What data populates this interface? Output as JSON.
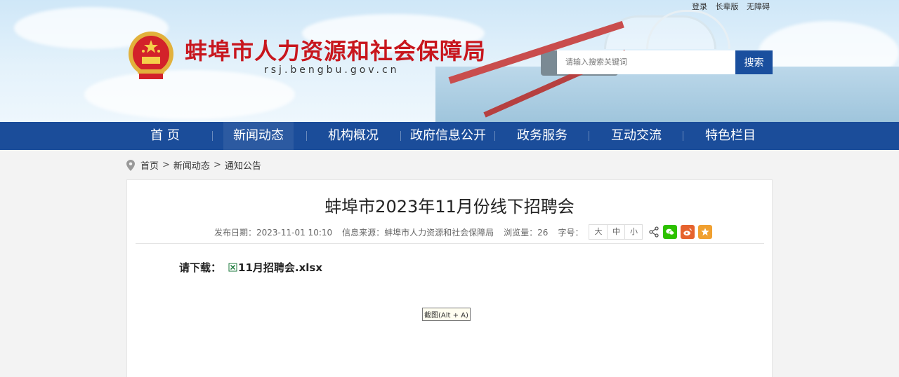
{
  "top_links": [
    "登录",
    "长辈版",
    "无障碍"
  ],
  "site": {
    "title": "蚌埠市人力资源和社会保障局",
    "domain": "rsj.bengbu.gov.cn"
  },
  "search": {
    "placeholder": "请输入搜索关键词",
    "button": "搜索"
  },
  "nav": [
    {
      "label": "首 页"
    },
    {
      "label": "新闻动态"
    },
    {
      "label": "机构概况"
    },
    {
      "label": "政府信息公开"
    },
    {
      "label": "政务服务"
    },
    {
      "label": "互动交流"
    },
    {
      "label": "特色栏目"
    }
  ],
  "breadcrumb": [
    "首页",
    "新闻动态",
    "通知公告"
  ],
  "breadcrumb_sep": ">",
  "article": {
    "title": "蚌埠市2023年11月份线下招聘会",
    "publish_date": "发布日期：2023-11-01 10:10",
    "source": "信息来源：蚌埠市人力资源和社会保障局",
    "views": "浏览量：26",
    "font_label": "字号：",
    "font_sizes": [
      "大",
      "中",
      "小"
    ],
    "download_label": "请下载：",
    "attachment": "11月招聘会.xlsx"
  },
  "tooltip": "截图(Alt + A)",
  "colors": {
    "brand_red": "#c8161d",
    "nav_blue": "#1b4d9a",
    "search_blue": "#1a4f9e",
    "wechat": "#2dc100",
    "weibo": "#e6632e",
    "favorite": "#f0a030"
  },
  "icons": [
    "location-pin-icon",
    "share-icon",
    "wechat-icon",
    "weibo-icon",
    "favorite-icon",
    "excel-file-icon",
    "national-emblem"
  ]
}
